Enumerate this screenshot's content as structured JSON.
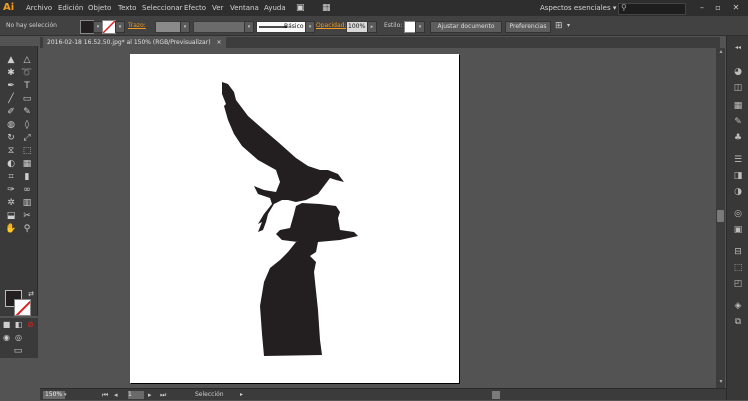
{
  "menubar": {
    "logo": "Ai",
    "items": [
      "Archivo",
      "Edición",
      "Objeto",
      "Texto",
      "Seleccionar",
      "Efecto",
      "Ver",
      "Ventana",
      "Ayuda"
    ],
    "workspace": "Aspectos esenciales",
    "window_controls": [
      "–",
      "▫",
      "✕"
    ]
  },
  "controlbar": {
    "selection_status": "No hay selección",
    "stroke_label": "Trazo:",
    "stroke_style": "Básico",
    "opacity_label": "Opacidad:",
    "opacity_value": "100%",
    "style_label": "Estilo:",
    "align_doc": "Ajustar documento",
    "preferences": "Preferencias",
    "accent": "#f29b22"
  },
  "tab": {
    "title": "2016-02-18 16.52.50.jpg* al 150% (RGB/Previsualizar)",
    "close": "×"
  },
  "toolbar": {
    "icons": [
      "selection-tool",
      "direct-selection-tool",
      "magic-wand-tool",
      "lasso-tool",
      "pen-tool",
      "type-tool",
      "line-tool",
      "rectangle-tool",
      "paintbrush-tool",
      "pencil-tool",
      "blob-brush-tool",
      "eraser-tool",
      "rotate-tool",
      "scale-tool",
      "width-tool",
      "free-transform-tool",
      "shape-builder-tool",
      "perspective-grid-tool",
      "mesh-tool",
      "gradient-tool",
      "eyedropper-tool",
      "blend-tool",
      "symbol-sprayer-tool",
      "column-graph-tool",
      "artboard-tool",
      "slice-tool",
      "hand-tool",
      "zoom-tool"
    ],
    "fill_color": "#231f20",
    "stroke_color": "none"
  },
  "status": {
    "zoom": "150%",
    "page": "1",
    "tool": "Selección"
  }
}
